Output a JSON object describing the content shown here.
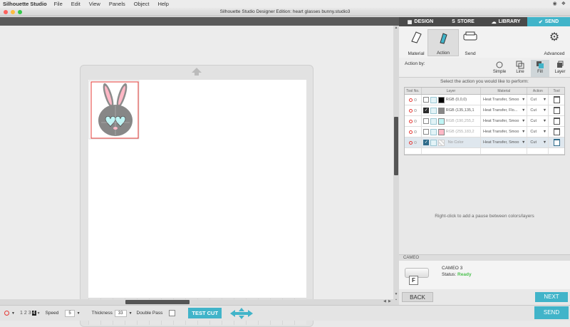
{
  "menubar": {
    "app_name": "Silhouette Studio",
    "items": [
      "File",
      "Edit",
      "View",
      "Panels",
      "Object",
      "Help"
    ],
    "clock_icon": "clock-icon",
    "dropbox_icon": "dropbox-icon"
  },
  "window": {
    "title": "Silhouette Studio Designer Edition: heart glasses bunny.studio3"
  },
  "top_tabs": [
    {
      "label": "DESIGN",
      "icon": "grid-icon",
      "active": false
    },
    {
      "label": "STORE",
      "icon": "store-icon",
      "active": false
    },
    {
      "label": "LIBRARY",
      "icon": "cloud-icon",
      "active": false
    },
    {
      "label": "SEND",
      "icon": "send-icon",
      "active": true
    }
  ],
  "send_tabs": {
    "material": "Material",
    "action": "Action",
    "send": "Send",
    "advanced": "Advanced"
  },
  "action_by": {
    "label": "Action by:",
    "modes": [
      "Simple",
      "Line",
      "Fill",
      "Layer"
    ],
    "active": "Fill"
  },
  "instruction": "Select the action you would like to perform:",
  "table": {
    "headers": [
      "Tool No.",
      "Layer",
      "Material",
      "Action",
      "Tool"
    ],
    "rows": [
      {
        "checked": false,
        "color": "#000000",
        "label": "RGB (0,0,0)",
        "material": "Heat Transfer, Smoo",
        "action": "Cut"
      },
      {
        "checked": true,
        "color": "#878787",
        "label": "RGB (135,135,1",
        "material": "Heat Transfer, Flo...",
        "action": "Cut"
      },
      {
        "checked": false,
        "color": "#BEF5F5",
        "label": "RGB (190,255,2",
        "material": "Heat Transfer, Smoo",
        "action": "Cut"
      },
      {
        "checked": false,
        "color": "#FFB7C5",
        "label": "RGB (255,183,2",
        "material": "Heat Transfer, Smoo",
        "action": "Cut"
      },
      {
        "checked": true,
        "color": "none",
        "label": "No Color",
        "material": "Heat Transfer, Smoo",
        "action": "Cut"
      }
    ]
  },
  "hint": "Right-click to add a pause between colors/layers",
  "cameo": {
    "header": "CAMEO",
    "model": "CAMEO 3",
    "status_label": "Status:",
    "status": "Ready",
    "letter": "F"
  },
  "buttons": {
    "back": "BACK",
    "next": "NEXT",
    "send": "SEND"
  },
  "bottombar": {
    "pass_digits": [
      "1",
      "2",
      "3",
      "4"
    ],
    "speed_label": "Speed",
    "speed_value": "5",
    "thickness_label": "Thickness",
    "thickness_value": "33",
    "double_pass_label": "Double Pass",
    "test_cut": "TEST CUT"
  },
  "colors": {
    "accent": "#41B4C9",
    "dark": "#4A4A4A",
    "ready": "#4CC14F"
  }
}
